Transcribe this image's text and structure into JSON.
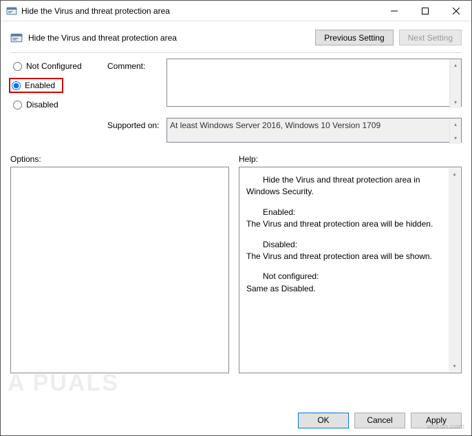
{
  "window": {
    "title": "Hide the Virus and threat protection area"
  },
  "header": {
    "name": "Hide the Virus and threat protection area",
    "prev": "Previous Setting",
    "next": "Next Setting"
  },
  "state": {
    "not_configured": "Not Configured",
    "enabled": "Enabled",
    "disabled": "Disabled",
    "selected": "enabled"
  },
  "labels": {
    "comment": "Comment:",
    "supported": "Supported on:",
    "options": "Options:",
    "help": "Help:"
  },
  "fields": {
    "comment": "",
    "supported": "At least Windows Server 2016, Windows 10 Version 1709"
  },
  "help": {
    "p1": "Hide the Virus and threat protection area in Windows Security.",
    "p2a": "Enabled:",
    "p2b": "The Virus and threat protection area will be hidden.",
    "p3a": "Disabled:",
    "p3b": "The Virus and threat protection area will be shown.",
    "p4a": "Not configured:",
    "p4b": "Same as Disabled."
  },
  "footer": {
    "ok": "OK",
    "cancel": "Cancel",
    "apply": "Apply"
  },
  "watermark": {
    "brand": "A   PUALS",
    "site": "wsxdn.com"
  }
}
